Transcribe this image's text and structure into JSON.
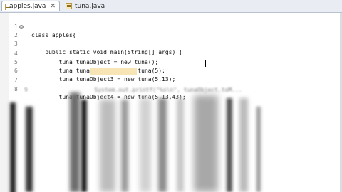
{
  "tabs": [
    {
      "label": "apples.java",
      "close": "✕",
      "active": true
    },
    {
      "label": "tuna.java",
      "active": false
    }
  ],
  "lines": [
    {
      "num": "1",
      "code": "class apples{"
    },
    {
      "num": "2",
      "fold": "⊖",
      "code": "    public static void main(String[] args) {"
    },
    {
      "num": "3",
      "code": ""
    },
    {
      "num": "4",
      "code": "        tuna tunaObject = new tuna();"
    },
    {
      "num": "5",
      "code": "        tuna tunaObject2 = new tuna(5);"
    },
    {
      "num": "6",
      "code": "        tuna tunaObject3 = new tuna(5,13);"
    },
    {
      "num": "7",
      "code": "        tuna tunaObject4 = new tuna(5,13,43);"
    },
    {
      "num": "8",
      "code": ""
    },
    {
      "num": "9",
      "code": "        System.out.printf(\"%s\\n\", tunaObject.toM..."
    }
  ]
}
